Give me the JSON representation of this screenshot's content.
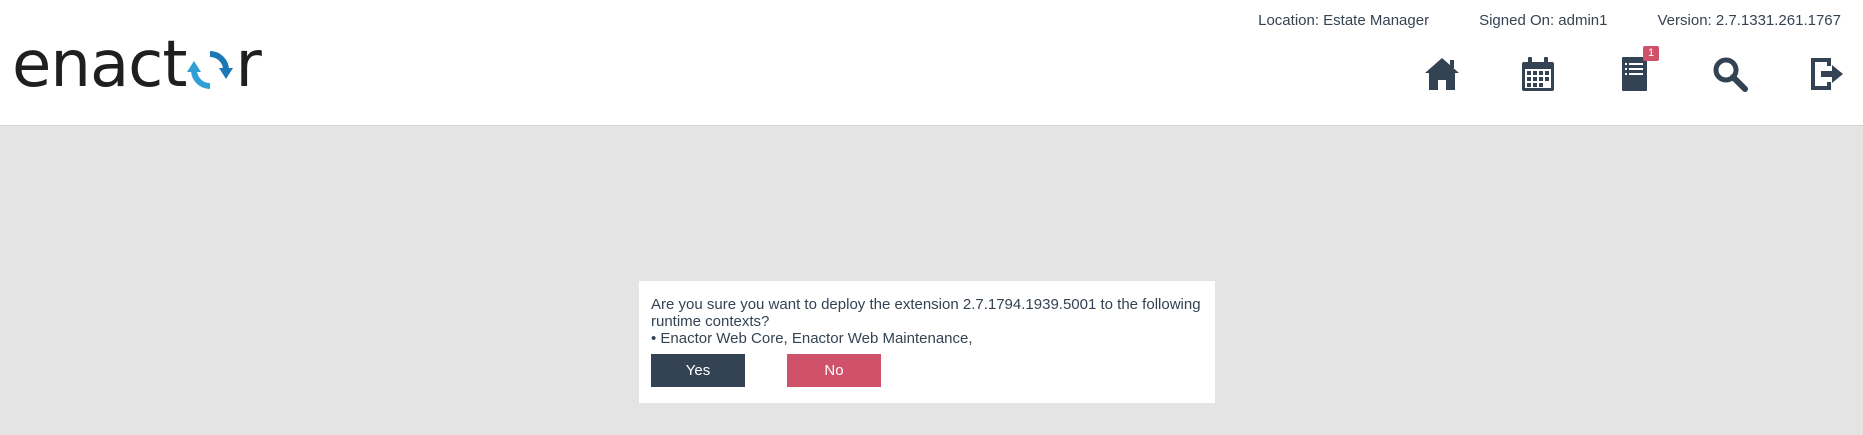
{
  "header": {
    "logo": {
      "text_before": "enact",
      "text_after": "r",
      "mark_colors": {
        "primary": "#2f9fd6",
        "secondary": "#1b77b5"
      }
    },
    "location": "Location: Estate Manager",
    "signed_on": "Signed On: admin1",
    "version": "Version: 2.7.1331.261.1767",
    "icons": [
      {
        "name": "home-icon"
      },
      {
        "name": "calendar-icon"
      },
      {
        "name": "tasks-icon",
        "badge": "1"
      },
      {
        "name": "search-icon"
      },
      {
        "name": "logout-icon"
      }
    ]
  },
  "dialog": {
    "line1": "Are you sure you want to deploy the extension 2.7.1794.1939.5001 to the following runtime contexts?",
    "line2": "• Enactor Web Core, Enactor Web Maintenance,",
    "yes_label": "Yes",
    "no_label": "No"
  },
  "colors": {
    "background": "#e4e4e4",
    "dark": "#344353",
    "danger": "#d0526a"
  }
}
